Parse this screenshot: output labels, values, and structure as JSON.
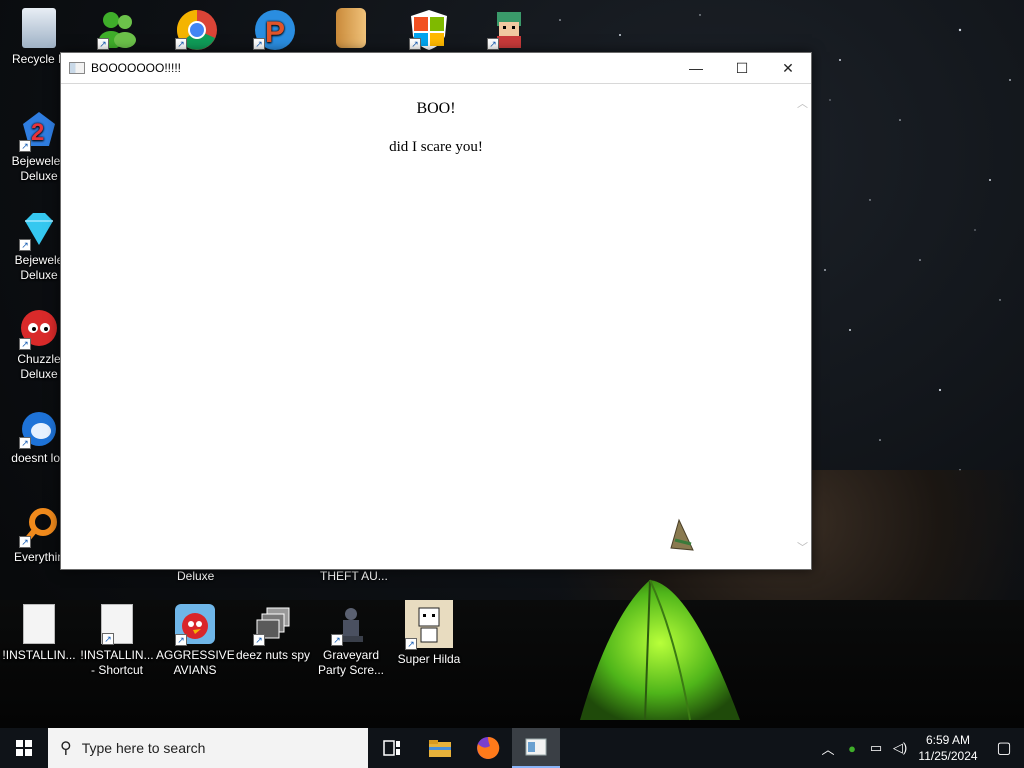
{
  "desktop": {
    "icons_top": [
      {
        "label": "Recycle B",
        "icon": "recycle-bin-icon"
      },
      {
        "label": "",
        "icon": "messenger-icon"
      },
      {
        "label": "",
        "icon": "chrome-icon"
      },
      {
        "label": "",
        "icon": "p-app-icon"
      },
      {
        "label": "",
        "icon": "folder-app-icon"
      },
      {
        "label": "",
        "icon": "windows-shield-icon"
      },
      {
        "label": "",
        "icon": "pixel-character-icon"
      }
    ],
    "icons_left": [
      {
        "line1": "Bejewelec",
        "line2": "Deluxe",
        "icon": "bejeweled-2-icon"
      },
      {
        "line1": "Bejewele",
        "line2": "Deluxe",
        "icon": "bejeweled-diamond-icon"
      },
      {
        "line1": "Chuzzle",
        "line2": "Deluxe",
        "icon": "chuzzle-icon"
      },
      {
        "line1": "doesnt loa",
        "line2": "",
        "icon": "blue-bird-icon"
      },
      {
        "line1": "Everythin",
        "line2": "",
        "icon": "everything-search-icon"
      }
    ],
    "partial_labels": {
      "deluxe": "Deluxe",
      "theft": "THEFT AU..."
    },
    "icons_bottom": [
      {
        "line1": "!INSTALLIN...",
        "line2": "",
        "icon": "document-icon"
      },
      {
        "line1": "!INSTALLIN...",
        "line2": "- Shortcut",
        "icon": "document-shortcut-icon"
      },
      {
        "line1": "AGGRESSIVE",
        "line2": "AVIANS",
        "icon": "angry-bird-icon"
      },
      {
        "line1": "deez nuts spy",
        "line2": "",
        "icon": "windows-stack-icon"
      },
      {
        "line1": "Graveyard",
        "line2": "Party Scre...",
        "icon": "graveyard-statue-icon"
      },
      {
        "line1": "Super Hilda",
        "line2": "",
        "icon": "super-hilda-icon"
      }
    ]
  },
  "window": {
    "title": "BOOOOOOO!!!!!",
    "heading": "BOO!",
    "message": "did I scare you!",
    "minimize": "—",
    "maximize": "☐",
    "close": "✕"
  },
  "taskbar": {
    "search_placeholder": "Type here to search",
    "time": "6:59 AM",
    "date": "11/25/2024"
  }
}
